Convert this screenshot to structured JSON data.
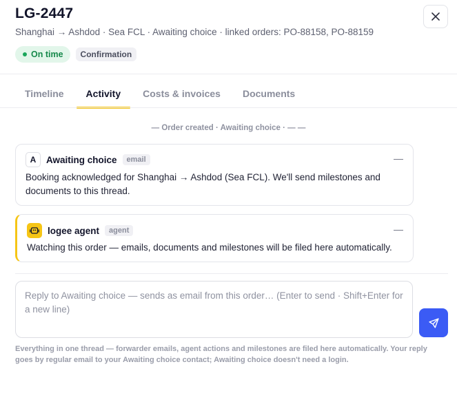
{
  "header": {
    "title": "LG-2447",
    "subtitle": "Shanghai → Ashdod · Sea FCL · Awaiting choice · linked orders: PO-88158, PO-88159",
    "status_badge": "On time",
    "stage_badge": "Confirmation",
    "close_icon": "close-icon"
  },
  "tabs": [
    {
      "label": "Timeline",
      "active": false
    },
    {
      "label": "Activity",
      "active": true
    },
    {
      "label": "Costs & invoices",
      "active": false
    },
    {
      "label": "Documents",
      "active": false
    }
  ],
  "activity": {
    "divider": "— Order created · Awaiting choice · — —",
    "messages": [
      {
        "avatar": "A",
        "sender": "Awaiting choice",
        "channel": "email",
        "menu": "—",
        "body": "Booking acknowledged for Shanghai → Ashdod (Sea FCL). We'll send milestones and documents to this thread."
      },
      {
        "avatar_icon": "robot-icon",
        "sender": "logee agent",
        "channel": "agent",
        "menu": "—",
        "body": "Watching this order — emails, documents and milestones will be filed here automatically."
      }
    ]
  },
  "composer": {
    "placeholder": "Reply to Awaiting choice — sends as email from this order… (Enter to send · Shift+Enter for a new line)",
    "value": "",
    "send_icon": "send-icon",
    "footnote": "Everything in one thread — forwarder emails, agent actions and milestones are filed here automatically. Your reply goes by regular email to your Awaiting choice contact; Awaiting choice doesn't need a login."
  },
  "colors": {
    "accent": "#f6c515",
    "send": "#3b5bf5",
    "on_time_bg": "#e2f6ea",
    "on_time_text": "#16894b"
  }
}
